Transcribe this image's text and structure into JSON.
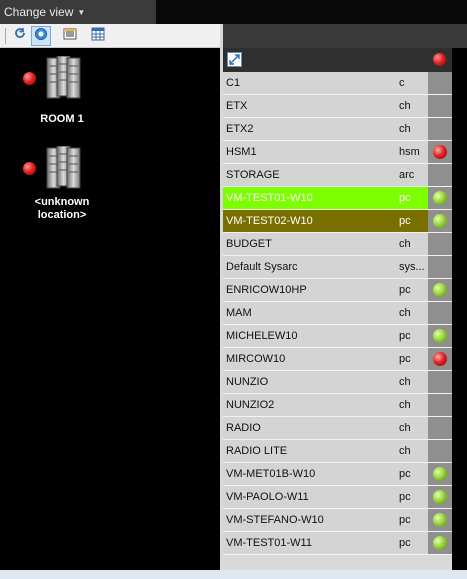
{
  "top": {
    "change_view_label": "Change view"
  },
  "toolbar": {
    "icons": [
      "refresh-icon",
      "target-icon",
      "list-view-icon",
      "calendar-grid-icon"
    ]
  },
  "locations": [
    {
      "label": "ROOM 1",
      "status": "red"
    },
    {
      "label": "<unknown location>",
      "status": "red"
    }
  ],
  "list_header": {
    "status": "red"
  },
  "devices": [
    {
      "name": "C1",
      "type": "c",
      "status": "none",
      "highlight": ""
    },
    {
      "name": "ETX",
      "type": "ch",
      "status": "none",
      "highlight": ""
    },
    {
      "name": "ETX2",
      "type": "ch",
      "status": "none",
      "highlight": ""
    },
    {
      "name": "HSM1",
      "type": "hsm",
      "status": "red",
      "highlight": ""
    },
    {
      "name": "STORAGE",
      "type": "arc",
      "status": "none",
      "highlight": ""
    },
    {
      "name": "VM-TEST01-W10",
      "type": "pc",
      "status": "green",
      "highlight": "green"
    },
    {
      "name": "VM-TEST02-W10",
      "type": "pc",
      "status": "green",
      "highlight": "olive"
    },
    {
      "name": "BUDGET",
      "type": "ch",
      "status": "none",
      "highlight": ""
    },
    {
      "name": "Default Sysarc",
      "type": "sys...",
      "status": "none",
      "highlight": ""
    },
    {
      "name": "ENRICOW10HP",
      "type": "pc",
      "status": "green",
      "highlight": ""
    },
    {
      "name": "MAM",
      "type": "ch",
      "status": "none",
      "highlight": ""
    },
    {
      "name": "MICHELEW10",
      "type": "pc",
      "status": "green",
      "highlight": ""
    },
    {
      "name": "MIRCOW10",
      "type": "pc",
      "status": "red",
      "highlight": ""
    },
    {
      "name": "NUNZIO",
      "type": "ch",
      "status": "none",
      "highlight": ""
    },
    {
      "name": "NUNZIO2",
      "type": "ch",
      "status": "none",
      "highlight": ""
    },
    {
      "name": "RADIO",
      "type": "ch",
      "status": "none",
      "highlight": ""
    },
    {
      "name": "RADIO LITE",
      "type": "ch",
      "status": "none",
      "highlight": ""
    },
    {
      "name": "VM-MET01B-W10",
      "type": "pc",
      "status": "green",
      "highlight": ""
    },
    {
      "name": "VM-PAOLO-W11",
      "type": "pc",
      "status": "green",
      "highlight": ""
    },
    {
      "name": "VM-STEFANO-W10",
      "type": "pc",
      "status": "green",
      "highlight": ""
    },
    {
      "name": "VM-TEST01-W11",
      "type": "pc",
      "status": "green",
      "highlight": ""
    }
  ]
}
